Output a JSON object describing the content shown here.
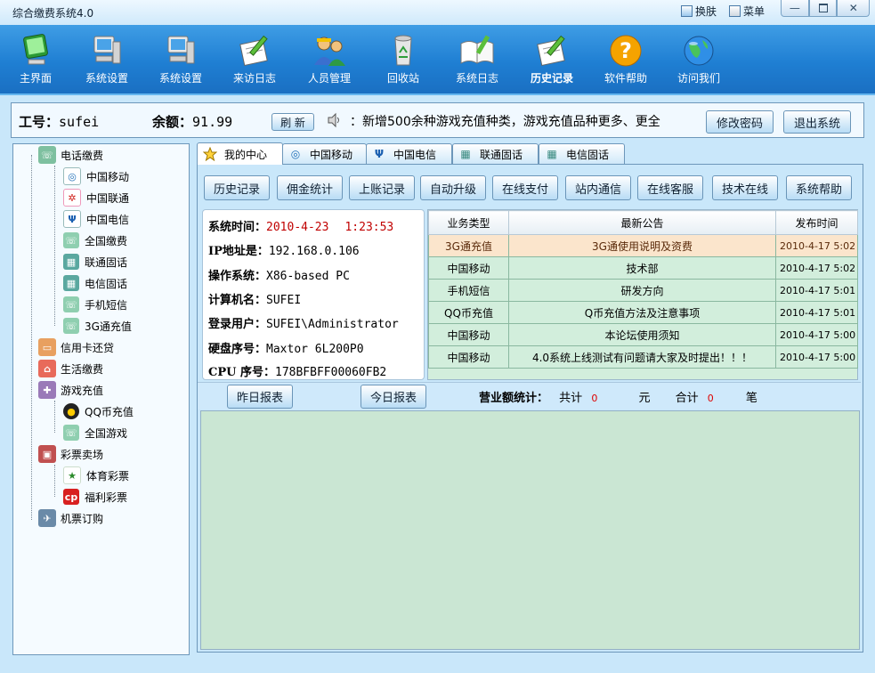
{
  "window": {
    "title": "综合缴费系统4.0",
    "links": [
      {
        "label": "换肤"
      },
      {
        "label": "菜单"
      }
    ],
    "controls": [
      "minimize",
      "maximize",
      "close"
    ]
  },
  "toolbar": {
    "items": [
      {
        "label": "主界面",
        "icon": "monitor-icon"
      },
      {
        "label": "系统设置",
        "icon": "computer-icon"
      },
      {
        "label": "系统设置",
        "icon": "computer-icon"
      },
      {
        "label": "来访日志",
        "icon": "notepad-pen-icon"
      },
      {
        "label": "人员管理",
        "icon": "users-icon"
      },
      {
        "label": "回收站",
        "icon": "recycle-bin-icon"
      },
      {
        "label": "系统日志",
        "icon": "open-book-icon"
      },
      {
        "label": "历史记录",
        "icon": "notepad-pen-icon",
        "active": true
      },
      {
        "label": "软件帮助",
        "icon": "help-icon"
      },
      {
        "label": "访问我们",
        "icon": "globe-icon"
      }
    ]
  },
  "status": {
    "id_label": "工号：",
    "id_value": "sufei",
    "balance_label": "余额：",
    "balance_value": "91.99",
    "refresh_label": "刷 新",
    "marquee": "：新增500余种游戏充值种类，游戏充值品种更多、更全",
    "change_pwd_label": "修改密码",
    "exit_label": "退出系统"
  },
  "tree": {
    "groups": [
      {
        "label": "电话缴费",
        "icon": "phone-card-icon",
        "color": "#7ec0a0",
        "children": [
          {
            "label": "中国移动",
            "icon": "china-mobile-icon"
          },
          {
            "label": "中国联通",
            "icon": "china-unicom-icon"
          },
          {
            "label": "中国电信",
            "icon": "china-telecom-icon"
          },
          {
            "label": "全国缴费",
            "icon": "phone-card-icon"
          },
          {
            "label": "联通固话",
            "icon": "landline-icon"
          },
          {
            "label": "电信固话",
            "icon": "landline-icon"
          },
          {
            "label": "手机短信",
            "icon": "phone-card-icon"
          },
          {
            "label": "3G通充值",
            "icon": "phone-card-icon"
          }
        ]
      },
      {
        "label": "信用卡还贷",
        "icon": "credit-card-icon",
        "color": "#e8a060",
        "children": []
      },
      {
        "label": "生活缴费",
        "icon": "house-icon",
        "color": "#e86a5a",
        "children": []
      },
      {
        "label": "游戏充值",
        "icon": "gamepad-icon",
        "color": "#9a7ab8",
        "children": [
          {
            "label": "QQ币充值",
            "icon": "qq-penguin-icon"
          },
          {
            "label": "全国游戏",
            "icon": "phone-card-icon"
          }
        ]
      },
      {
        "label": "彩票卖场",
        "icon": "lottery-icon",
        "color": "#c05050",
        "children": [
          {
            "label": "体育彩票",
            "icon": "sports-lottery-icon"
          },
          {
            "label": "福利彩票",
            "icon": "welfare-lottery-icon"
          }
        ]
      },
      {
        "label": "机票订购",
        "icon": "airplane-icon",
        "color": "#6a8aa8",
        "children": []
      }
    ]
  },
  "tabs": [
    {
      "label": "我的中心",
      "icon": "star-icon",
      "active": true
    },
    {
      "label": "中国移动",
      "icon": "china-mobile-icon"
    },
    {
      "label": "中国电信",
      "icon": "china-telecom-icon"
    },
    {
      "label": "联通固话",
      "icon": "landline-icon"
    },
    {
      "label": "电信固话",
      "icon": "landline-icon"
    }
  ],
  "functions": [
    "历史记录",
    "佣金统计",
    "上账记录",
    "自动升级",
    "在线支付",
    "站内通信",
    "在线客服",
    "技术在线",
    "系统帮助"
  ],
  "sysinfo": {
    "time_label": "系统时间：",
    "time_date": "2010-4-23",
    "time_clock": "1:23:53",
    "ip_label": "IP地址是：",
    "ip_value": "192.168.0.106",
    "os_label": "操作系统：",
    "os_value": "X86-based PC",
    "host_label": "计算机名：",
    "host_value": "SUFEI",
    "user_label": "登录用户：",
    "user_value": "SUFEI\\Administrator",
    "disk_label": "硬盘序号：",
    "disk_value": "Maxtor 6L200P0",
    "cpu_label": "CPU 序号：",
    "cpu_value": "178BFBFF00060FB2"
  },
  "notices": {
    "headers": [
      "业务类型",
      "最新公告",
      "发布时间"
    ],
    "rows": [
      {
        "type": "3G通充值",
        "title": "3G通使用说明及资费",
        "time": "2010-4-17 5:02",
        "selected": true
      },
      {
        "type": "中国移动",
        "title": "技术部",
        "time": "2010-4-17 5:02"
      },
      {
        "type": "手机短信",
        "title": "研发方向",
        "time": "2010-4-17 5:01"
      },
      {
        "type": "QQ币充值",
        "title": "Q币充值方法及注意事项",
        "time": "2010-4-17 5:01"
      },
      {
        "type": "中国移动",
        "title": "本论坛使用须知",
        "time": "2010-4-17 5:00"
      },
      {
        "type": "中国移动",
        "title": "4.0系统上线测试有问题请大家及时提出！！！",
        "time": "2010-4-17 5:00"
      }
    ]
  },
  "report": {
    "yesterday_label": "昨日报表",
    "today_label": "今日报表",
    "stats_label": "营业额统计：",
    "total_label": "共计",
    "total_value": "0",
    "total_unit": "元",
    "sum_label": "合计",
    "sum_value": "0",
    "sum_unit": "笔"
  }
}
